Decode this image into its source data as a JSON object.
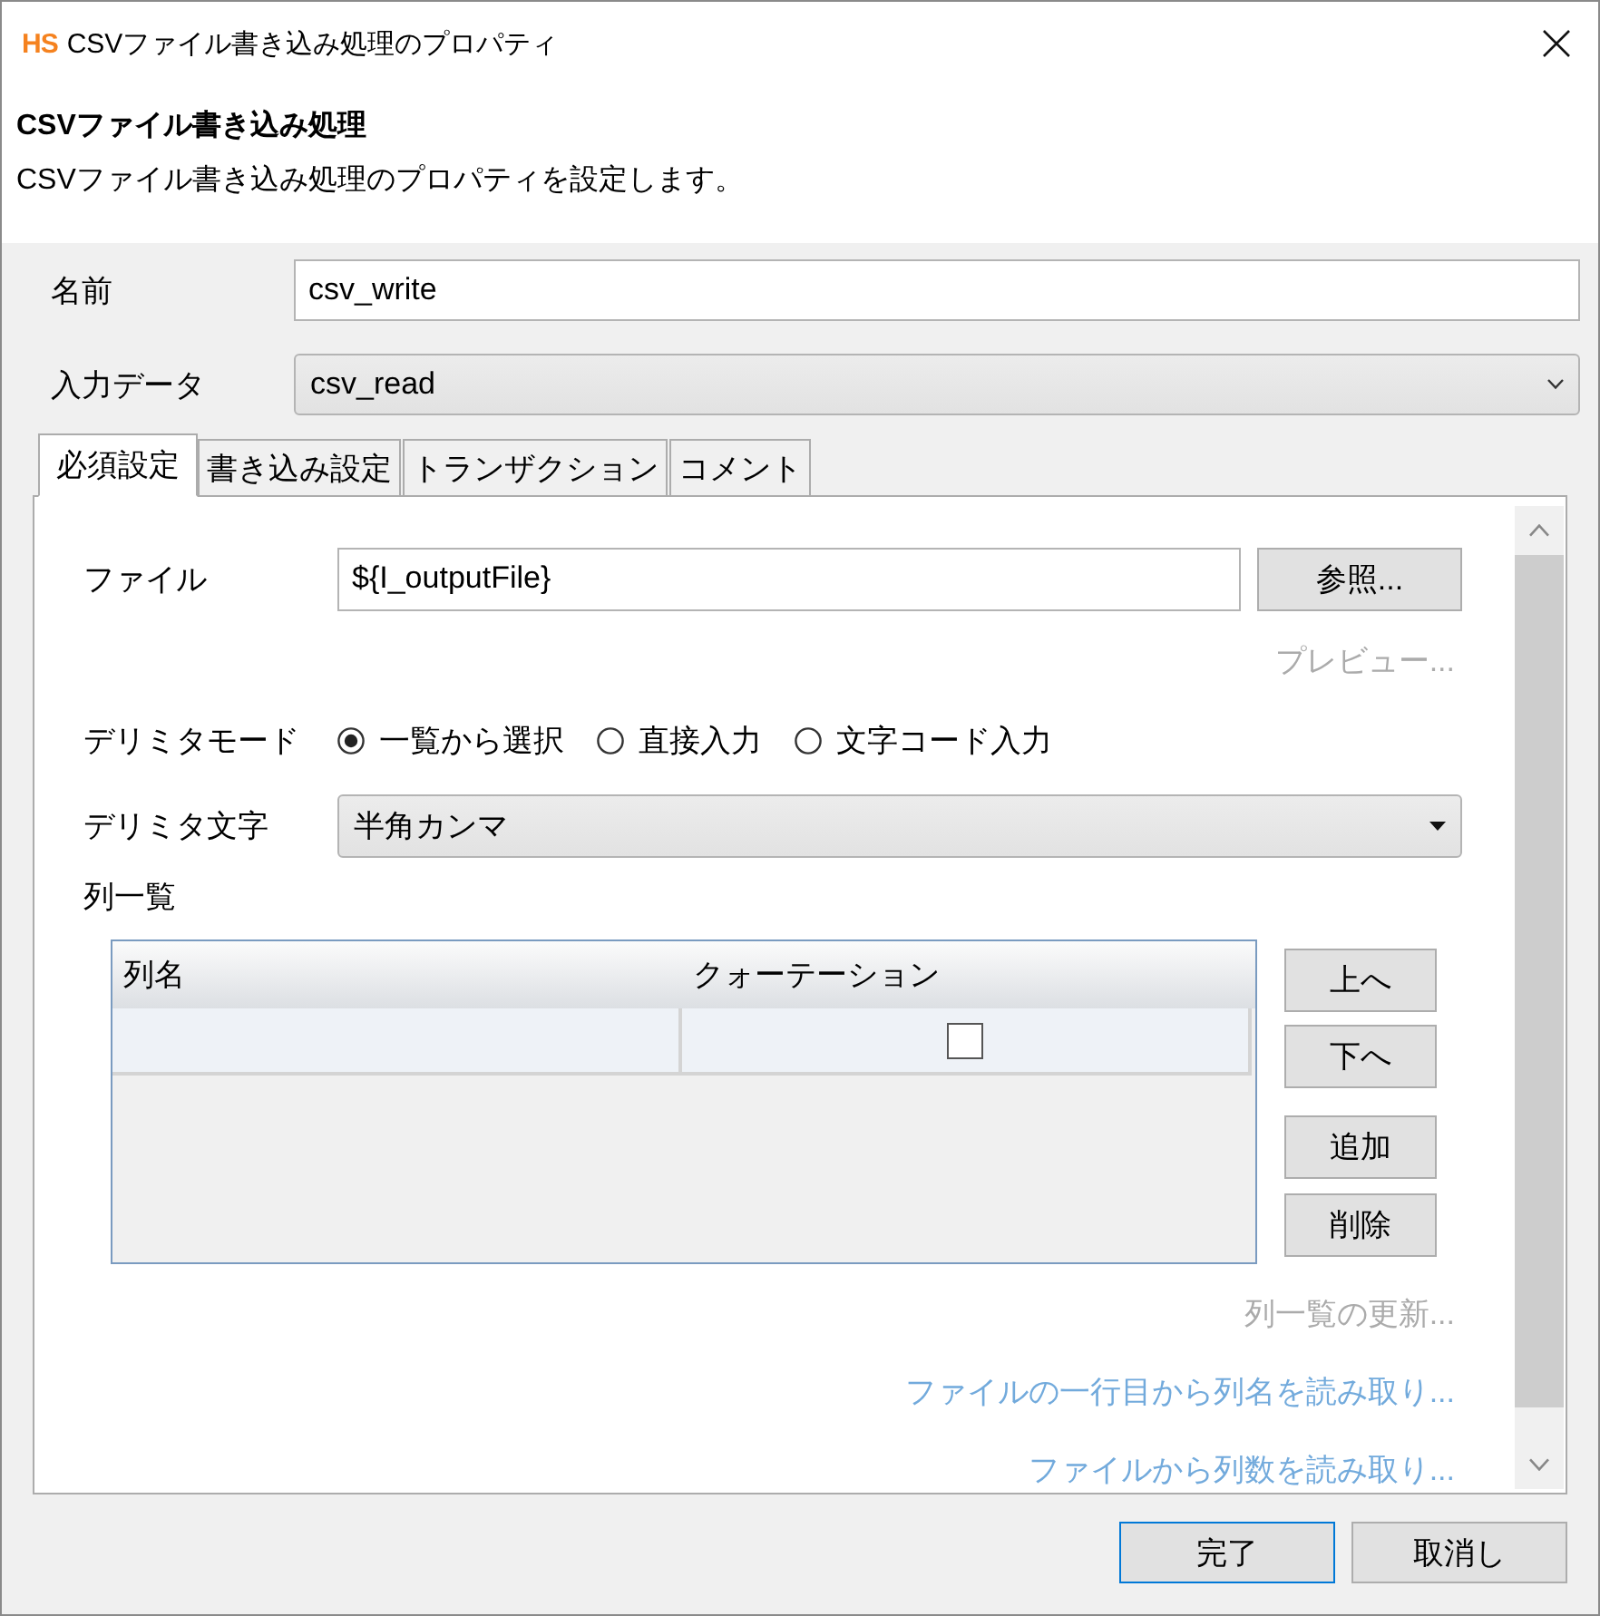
{
  "window": {
    "logo": "HS",
    "title": "CSVファイル書き込み処理のプロパティ"
  },
  "header": {
    "heading": "CSVファイル書き込み処理",
    "description": "CSVファイル書き込み処理のプロパティを設定します。"
  },
  "fields": [
    {
      "kind": "text",
      "label": "名前",
      "value": "csv_write"
    },
    {
      "kind": "dropdown",
      "label": "入力データ",
      "value": "csv_read"
    }
  ],
  "tabs": [
    {
      "label": "必須設定",
      "selected": true
    },
    {
      "label": "書き込み設定",
      "selected": false
    },
    {
      "label": "トランザクション",
      "selected": false
    },
    {
      "label": "コメント",
      "selected": false
    }
  ],
  "file": {
    "label": "ファイル",
    "value": "${I_outputFile}",
    "browse_button": "参照...",
    "preview_link": {
      "label": "プレビュー...",
      "disabled": true
    }
  },
  "delimiter_mode": {
    "label": "デリミタモード",
    "options": [
      {
        "label": "一覧から選択",
        "selected": true
      },
      {
        "label": "直接入力",
        "selected": false
      },
      {
        "label": "文字コード入力",
        "selected": false
      }
    ]
  },
  "delimiter_char": {
    "label": "デリミタ文字",
    "value": "半角カンマ"
  },
  "column_list": {
    "label": "列一覧",
    "table": {
      "columns": [
        "列名",
        "クォーテーション"
      ],
      "rows": [
        {
          "quoted": false
        }
      ]
    },
    "buttons": [
      "上へ",
      "下へ",
      "追加",
      "削除"
    ]
  },
  "links": [
    {
      "label": "列一覧の更新...",
      "disabled": true
    },
    {
      "label": "ファイルの一行目から列名を読み取り...",
      "disabled": false
    },
    {
      "label": "ファイルから列数を読み取り...",
      "disabled": false
    }
  ],
  "buttons": [
    {
      "label": "完了",
      "default": true
    },
    {
      "label": "取消し",
      "default": false
    }
  ]
}
